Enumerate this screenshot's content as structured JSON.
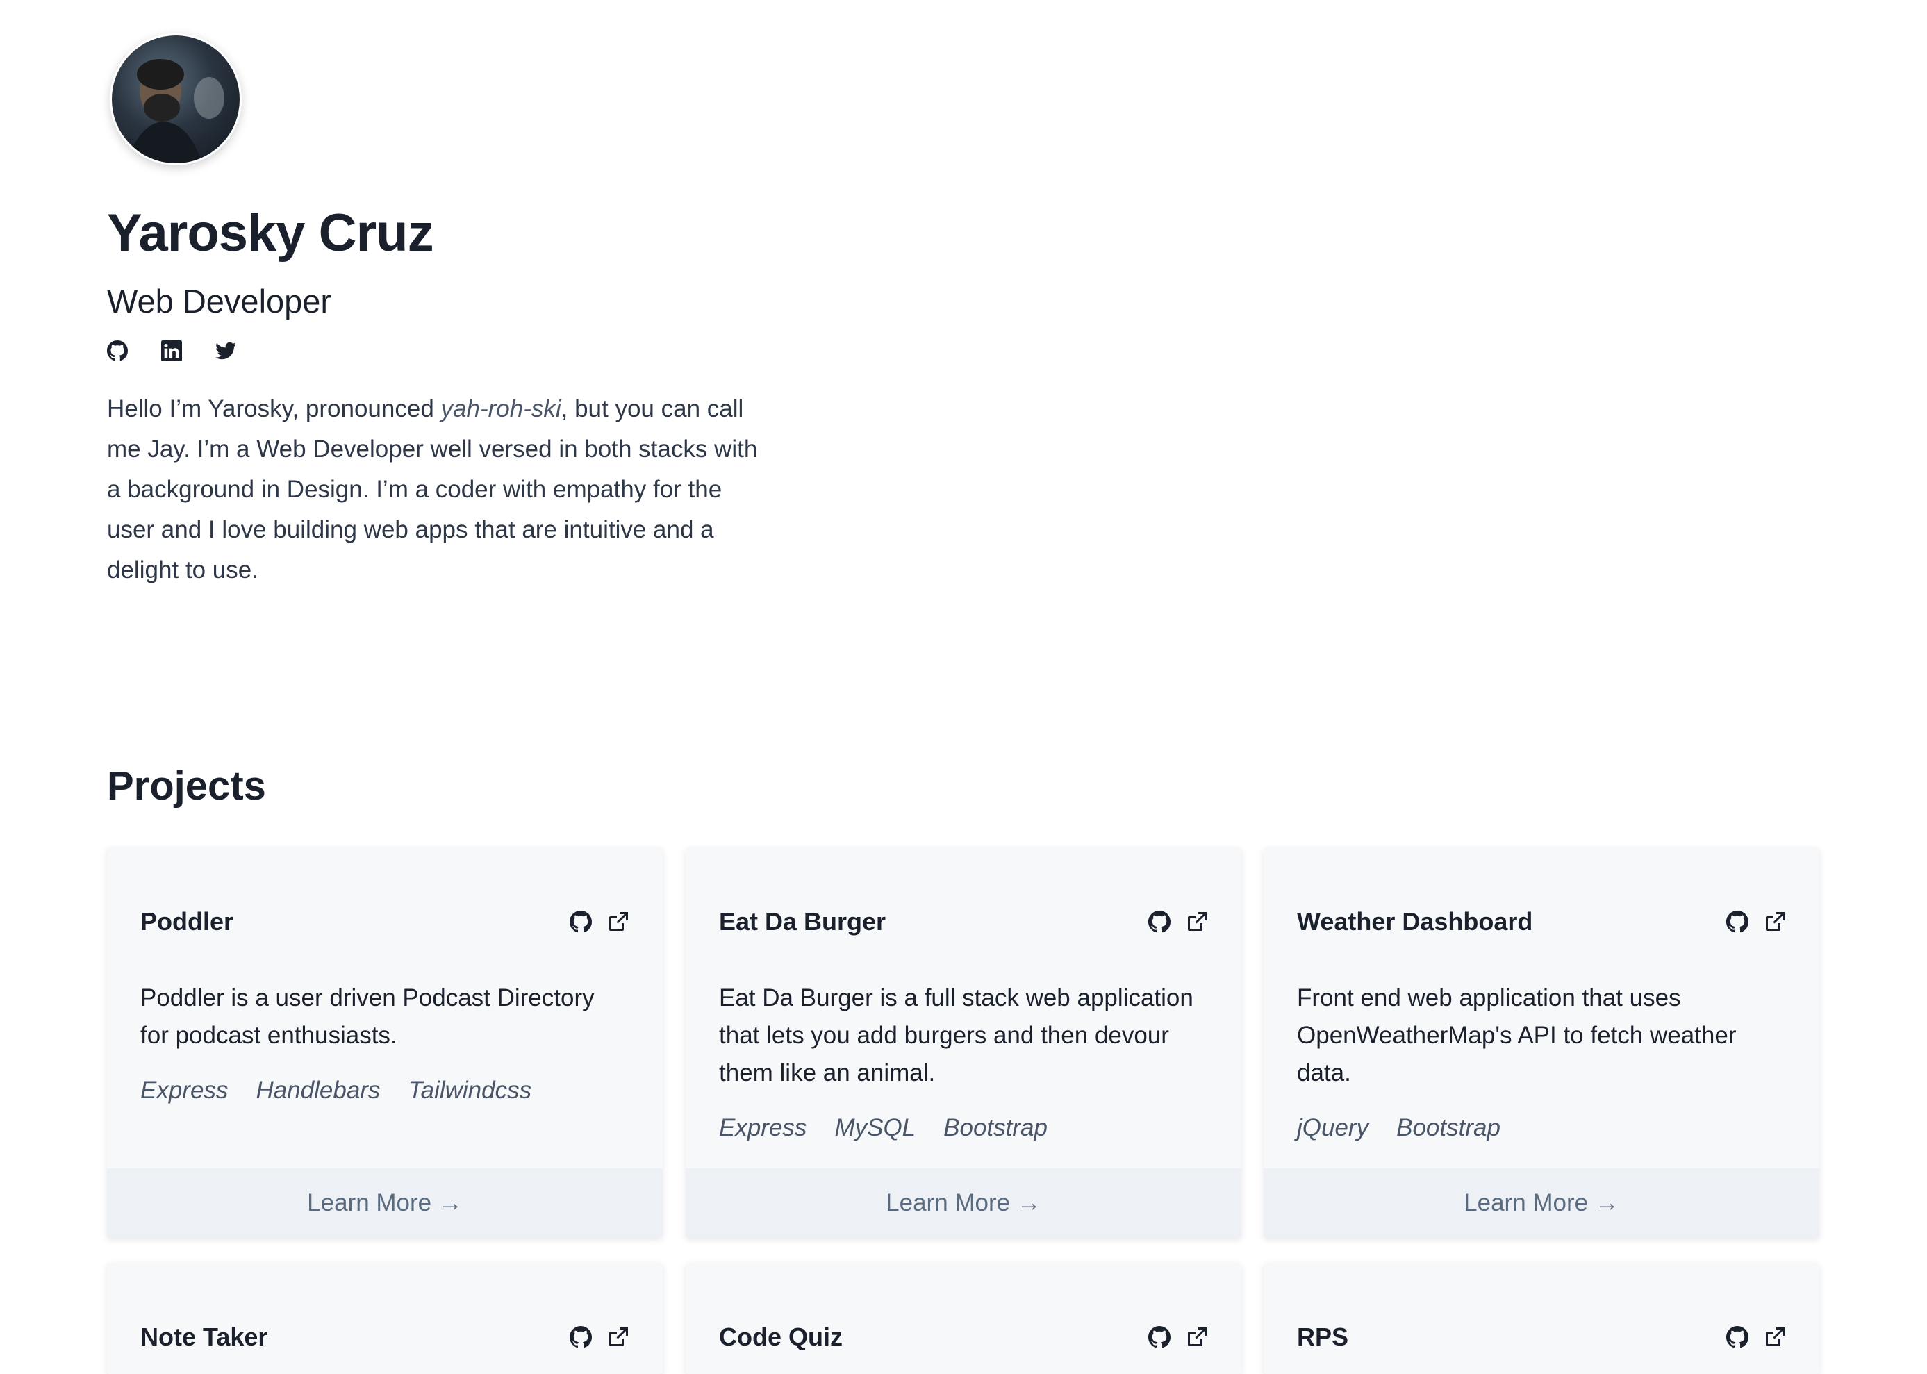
{
  "profile": {
    "name": "Yarosky Cruz",
    "role": "Web Developer",
    "avatar_icon": "profile-photo",
    "social_icons": [
      "github-icon",
      "linkedin-icon",
      "twitter-icon"
    ],
    "bio_before": "Hello I’m Yarosky, pronounced ",
    "bio_pronunciation": "yah-roh-ski",
    "bio_after": ", but you can call me Jay. I’m a Web Developer well versed in both stacks with a background in Design. I’m a coder with empathy for the user and I love building web apps that are intuitive and a delight to use."
  },
  "projects": {
    "title": "Projects",
    "learn_more_label": "Learn More →",
    "items": [
      {
        "title": "Poddler",
        "description": "Poddler is a user driven Podcast Directory for podcast enthusiasts.",
        "tags": [
          "Express",
          "Handlebars",
          "Tailwindcss"
        ]
      },
      {
        "title": "Eat Da Burger",
        "description": "Eat Da Burger is a full stack web application that lets you add burgers and then devour them like an animal.",
        "tags": [
          "Express",
          "MySQL",
          "Bootstrap"
        ]
      },
      {
        "title": "Weather Dashboard",
        "description": "Front end web application that uses OpenWeatherMap's API to fetch weather data.",
        "tags": [
          "jQuery",
          "Bootstrap"
        ]
      },
      {
        "title": "Note Taker"
      },
      {
        "title": "Code Quiz"
      },
      {
        "title": "RPS"
      }
    ]
  },
  "colors": {
    "text": "#1a202c",
    "card_bg": "#f7f8fa",
    "card_footer_bg": "#edf0f4",
    "learn_more": "#5a6b80"
  }
}
